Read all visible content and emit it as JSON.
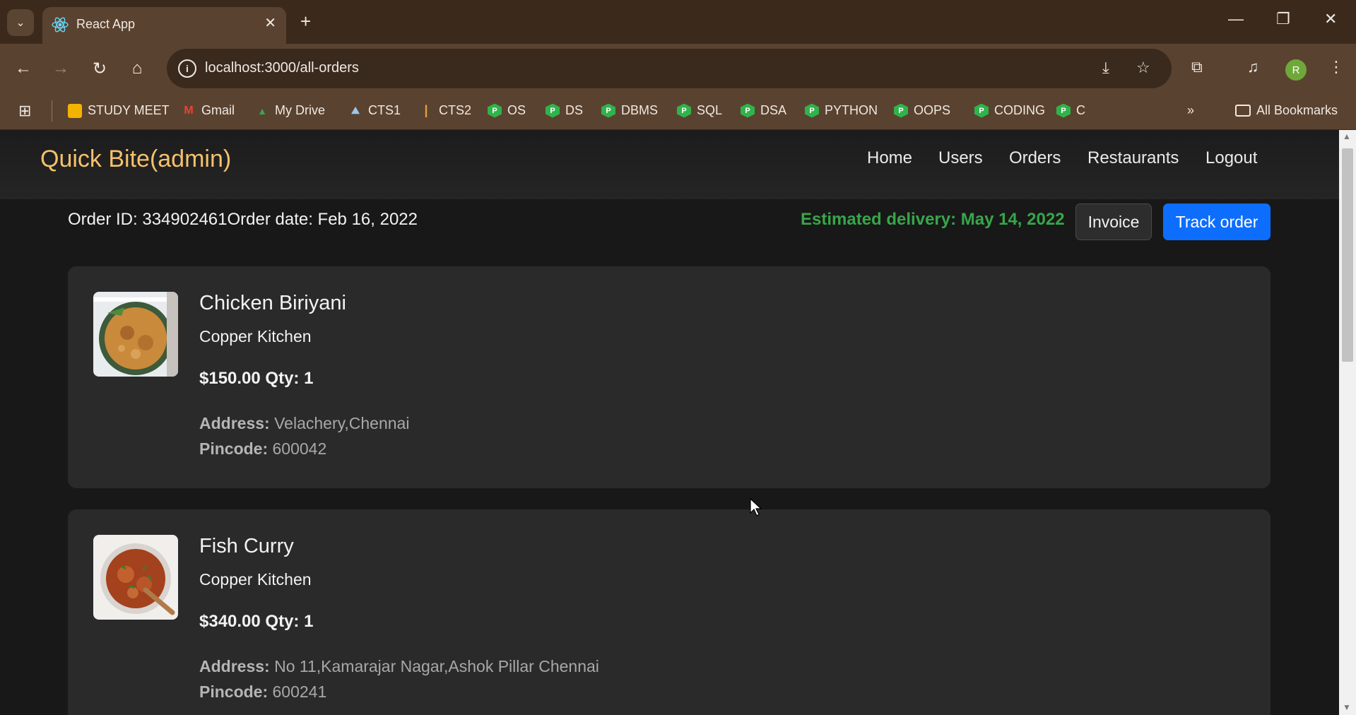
{
  "browser": {
    "tab_title": "React App",
    "url": "localhost:3000/all-orders",
    "profile_initial": "R",
    "bookmarks": [
      "STUDY MEET",
      "Gmail",
      "My Drive",
      "CTS1",
      "CTS2",
      "OS",
      "DS",
      "DBMS",
      "SQL",
      "DSA",
      "PYTHON",
      "OOPS",
      "CODING",
      "C"
    ],
    "all_bookmarks": "All Bookmarks"
  },
  "app": {
    "brand": "Quick Bite(admin)",
    "nav": [
      "Home",
      "Users",
      "Orders",
      "Restaurants",
      "Logout"
    ]
  },
  "order": {
    "id_text": "Order ID: 334902461",
    "date_text": "Order date: Feb 16, 2022",
    "estimated": "Estimated delivery: May 14, 2022",
    "invoice_label": "Invoice",
    "track_label": "Track order"
  },
  "items": [
    {
      "name": "Chicken Biriyani",
      "restaurant": "Copper Kitchen",
      "price_qty": "$150.00 Qty: 1",
      "address_label": "Address:",
      "address": "Velachery,Chennai",
      "pincode_label": "Pincode:",
      "pincode": "600042",
      "image_icon": "biryani-image"
    },
    {
      "name": "Fish Curry",
      "restaurant": "Copper Kitchen",
      "price_qty": "$340.00 Qty: 1",
      "address_label": "Address:",
      "address": "No 11,Kamarajar Nagar,Ashok Pillar Chennai",
      "pincode_label": "Pincode:",
      "pincode": "600241",
      "image_icon": "fish-curry-image"
    }
  ],
  "colors": {
    "brand": "#f5c16c",
    "estimated": "#37a64a",
    "track_button": "#0d6efd",
    "chrome": "#5a4230"
  }
}
